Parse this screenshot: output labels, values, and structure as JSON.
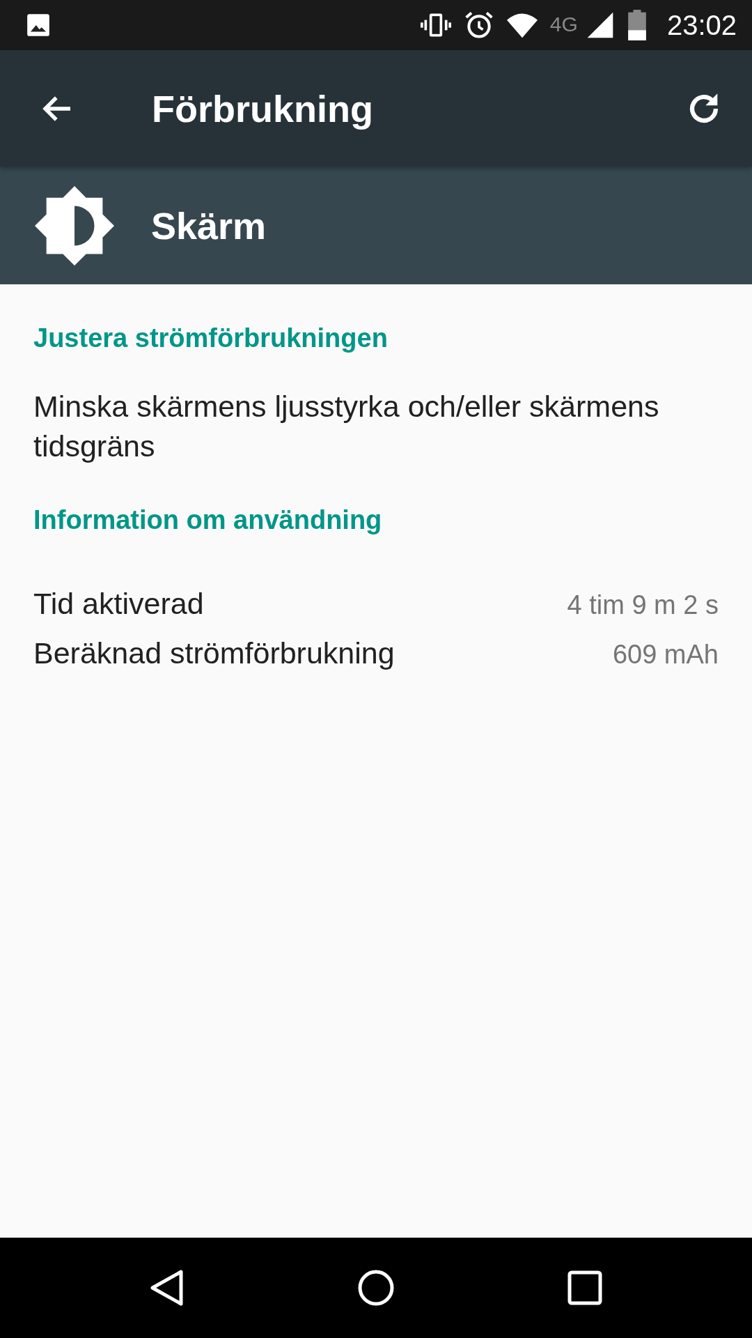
{
  "status_bar": {
    "network": "4G",
    "time": "23:02"
  },
  "toolbar": {
    "title": "Förbrukning"
  },
  "header": {
    "title": "Skärm"
  },
  "sections": [
    {
      "title": "Justera strömförbrukningen",
      "kind": "text",
      "text": "Minska skärmens ljusstyrka och/eller skärmens tidsgräns"
    },
    {
      "title": "Information om användning",
      "kind": "rows",
      "rows": [
        {
          "label": "Tid aktiverad",
          "value": "4 tim 9 m 2 s"
        },
        {
          "label": "Beräknad strömförbrukning",
          "value": "609 mAh"
        }
      ]
    }
  ]
}
